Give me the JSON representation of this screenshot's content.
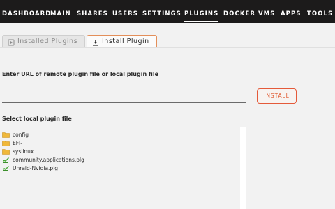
{
  "nav": {
    "items": [
      {
        "label": "DASHBOARD",
        "active": false
      },
      {
        "label": "MAIN",
        "active": false
      },
      {
        "label": "SHARES",
        "active": false
      },
      {
        "label": "USERS",
        "active": false
      },
      {
        "label": "SETTINGS",
        "active": false
      },
      {
        "label": "PLUGINS",
        "active": true
      },
      {
        "label": "DOCKER",
        "active": false
      },
      {
        "label": "VMS",
        "active": false
      },
      {
        "label": "APPS",
        "active": false
      },
      {
        "label": "TOOLS",
        "active": false
      }
    ]
  },
  "tabs": [
    {
      "label": "Installed Plugins",
      "icon": "plugin-icon",
      "active": false
    },
    {
      "label": "Install Plugin",
      "icon": "download-icon",
      "active": true
    }
  ],
  "install": {
    "url_label": "Enter URL of remote plugin file or local plugin file",
    "url_value": "",
    "button_label": "INSTALL"
  },
  "local": {
    "label": "Select local plugin file",
    "files": [
      {
        "name": "config",
        "icon": "folder-icon"
      },
      {
        "name": "EFI-",
        "icon": "folder-icon"
      },
      {
        "name": "syslinux",
        "icon": "folder-icon"
      },
      {
        "name": "community.applications.plg",
        "icon": "plugin-file-icon"
      },
      {
        "name": "Unraid-Nvidia.plg",
        "icon": "plugin-file-icon"
      }
    ]
  },
  "colors": {
    "nav_bg": "#1c1b1b",
    "accent": "#e45a3a",
    "folder": "#f0b83a",
    "plugin_file": "#4caa3a"
  }
}
